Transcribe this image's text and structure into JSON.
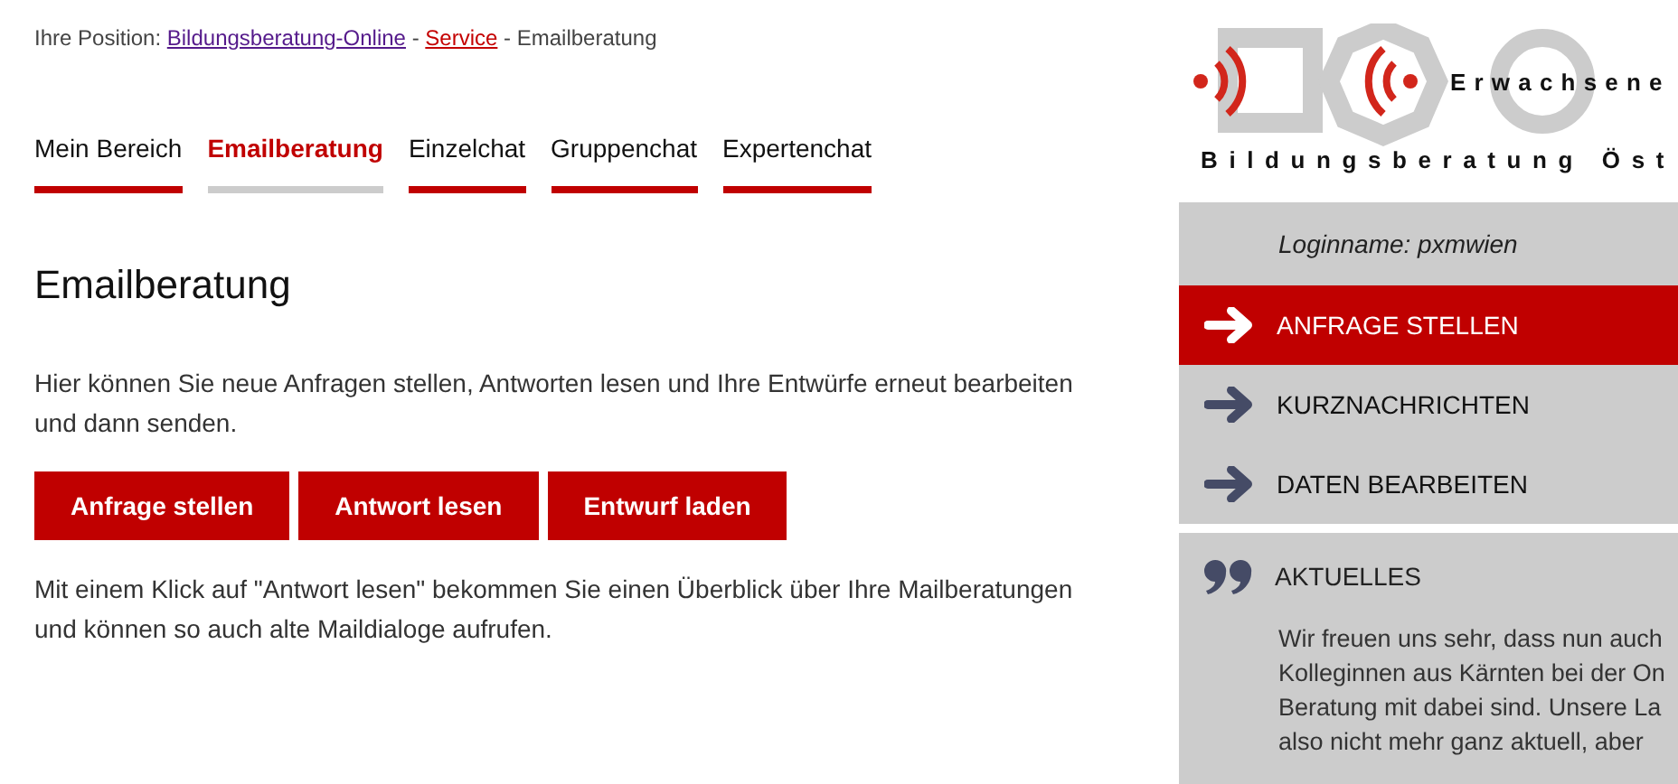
{
  "breadcrumb": {
    "label": "Ihre Position:",
    "items": [
      {
        "kind": "link",
        "text": "Bildungsberatung-Online",
        "visited": true
      },
      {
        "kind": "separator",
        "text": "-"
      },
      {
        "kind": "link",
        "text": "Service",
        "visited": false
      },
      {
        "kind": "separator",
        "text": "-"
      },
      {
        "kind": "current",
        "text": "Emailberatung"
      }
    ]
  },
  "tabs": [
    {
      "label": "Mein Bereich",
      "selected": false
    },
    {
      "label": "Emailberatung",
      "selected": true
    },
    {
      "label": "Einzelchat",
      "selected": false
    },
    {
      "label": "Gruppenchat",
      "selected": false
    },
    {
      "label": "Expertenchat",
      "selected": false
    }
  ],
  "heading": "Emailberatung",
  "intro": "Hier können Sie neue Anfragen stellen, Antworten lesen und Ihre Entwürfe erneut bearbeiten und dann senden.",
  "buttons": [
    "Anfrage stellen",
    "Antwort lesen",
    "Entwurf laden"
  ],
  "note": "Mit einem Klick auf \"Antwort lesen\" bekommen Sie einen Überblick über Ihre Mailberatungen und können so auch alte Maildialoge aufrufen.",
  "sidebar": {
    "logo": {
      "line1": "Erwachsene",
      "line2": "Bildungsberatung Öst"
    },
    "login": "Loginname: pxmwien",
    "menu": [
      {
        "label": "ANFRAGE STELLEN",
        "selected": true
      },
      {
        "label": "KURZNACHRICHTEN",
        "selected": false
      },
      {
        "label": "DATEN BEARBEITEN",
        "selected": false
      }
    ],
    "news": {
      "title": "AKTUELLES",
      "lines": [
        "Wir freuen uns sehr, dass nun auch",
        "Kolleginnen aus Kärnten bei der On",
        "Beratung mit dabei sind. Unsere La",
        "also nicht mehr ganz aktuell, aber"
      ]
    }
  }
}
